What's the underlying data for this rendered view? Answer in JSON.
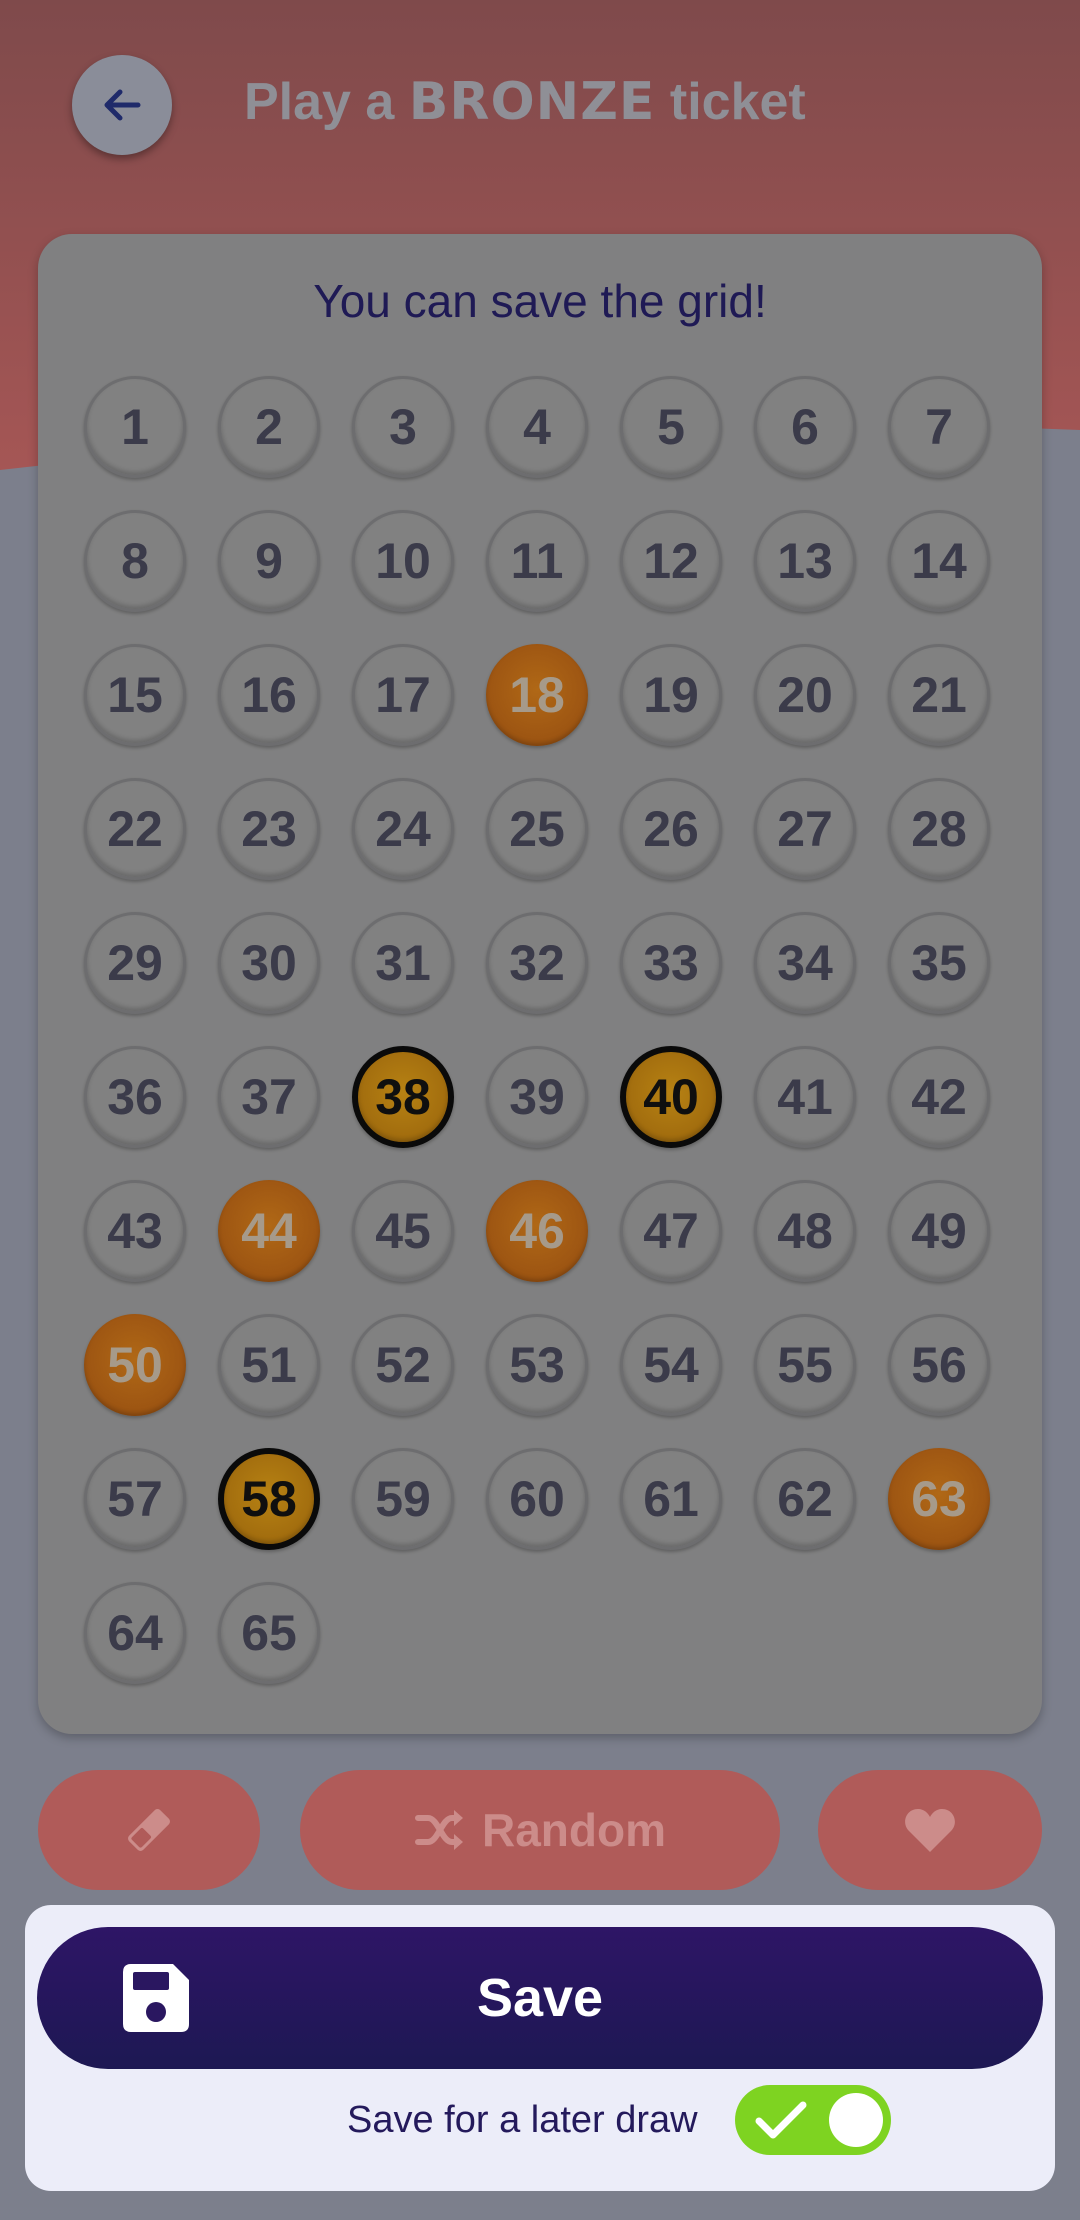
{
  "header": {
    "title_prefix": "Play a",
    "title_tier": "BRONZE",
    "title_suffix": "ticket",
    "back_icon": "arrow-left-icon"
  },
  "grid": {
    "title": "You can save the grid!",
    "numbers": [
      "1",
      "2",
      "3",
      "4",
      "5",
      "6",
      "7",
      "8",
      "9",
      "10",
      "11",
      "12",
      "13",
      "14",
      "15",
      "16",
      "17",
      "18",
      "19",
      "20",
      "21",
      "22",
      "23",
      "24",
      "25",
      "26",
      "27",
      "28",
      "29",
      "30",
      "31",
      "32",
      "33",
      "34",
      "35",
      "36",
      "37",
      "38",
      "39",
      "40",
      "41",
      "42",
      "43",
      "44",
      "45",
      "46",
      "47",
      "48",
      "49",
      "50",
      "51",
      "52",
      "53",
      "54",
      "55",
      "56",
      "57",
      "58",
      "59",
      "60",
      "61",
      "62",
      "63",
      "64",
      "65"
    ],
    "selected_orange": [
      "18",
      "44",
      "46",
      "50",
      "63"
    ],
    "selected_gold": [
      "38",
      "40",
      "58"
    ]
  },
  "actions": {
    "eraser_icon": "eraser-icon",
    "random_label": "Random",
    "random_icon": "shuffle-icon",
    "favorite_icon": "heart-icon"
  },
  "sheet": {
    "save_label": "Save",
    "save_icon": "floppy-disk-icon",
    "later_label": "Save for a later draw",
    "later_toggle_on": true
  },
  "colors": {
    "header_red": "#a55655",
    "primary": "#2e1566",
    "toggle_on": "#7ed321",
    "orange_ball": "#9c5412",
    "gold_ball": "#a16c0e"
  }
}
